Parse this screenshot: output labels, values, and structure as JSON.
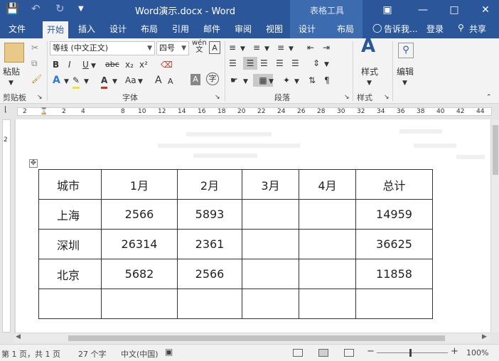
{
  "titlebar": {
    "title": "Word演示.docx - Word",
    "contextual_title": "表格工具",
    "save_icon": "save-icon",
    "undo_icon": "undo-icon",
    "redo_icon": "redo-icon"
  },
  "tabs": [
    "文件",
    "开始",
    "插入",
    "设计",
    "布局",
    "引用",
    "邮件",
    "审阅",
    "视图",
    "设计",
    "布局"
  ],
  "tabs_right": {
    "tell_me": "告诉我...",
    "login": "登录",
    "share": "共享"
  },
  "ribbon": {
    "paste_label": "粘贴",
    "font_name": "等线 (中文正文)",
    "font_size": "四号",
    "wen_label": "wén",
    "bold": "B",
    "italic": "I",
    "underline": "U",
    "strike": "abc",
    "sub": "x₂",
    "sup": "x²",
    "a_big": "A",
    "a_small": "A",
    "aa_label": "Aa",
    "style_label": "样式",
    "edit_label": "编辑",
    "groups": {
      "clipboard": "剪贴板",
      "font": "字体",
      "paragraph": "段落",
      "styles": "样式"
    }
  },
  "ruler": {
    "ticks": [
      "2",
      "2",
      "4",
      "8",
      "10",
      "12",
      "14",
      "16",
      "18",
      "20",
      "22",
      "24",
      "26",
      "28",
      "30",
      "32",
      "34",
      "36",
      "38",
      "40",
      "42",
      "44"
    ],
    "vticks": [
      "2"
    ]
  },
  "table": {
    "headers": [
      "城市",
      "1月",
      "2月",
      "3月",
      "4月",
      "总计"
    ],
    "rows": [
      [
        "上海",
        "2566",
        "5893",
        "",
        "",
        "14959"
      ],
      [
        "深圳",
        "26314",
        "2361",
        "",
        "",
        "36625"
      ],
      [
        "北京",
        "5682",
        "2566",
        "",
        "",
        "11858"
      ],
      [
        "",
        "",
        "",
        "",
        "",
        ""
      ]
    ]
  },
  "status": {
    "page": "第 1 页，共 1 页",
    "words": "27 个字",
    "language": "中文(中国)",
    "zoom": "100%"
  }
}
